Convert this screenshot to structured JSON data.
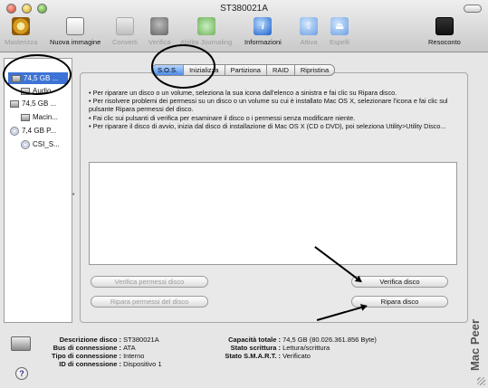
{
  "window": {
    "title": "ST380021A"
  },
  "toolbar": {
    "items": [
      {
        "label": "Masterizza",
        "icon": "burn-icon",
        "enabled": false
      },
      {
        "label": "Nuova immagine",
        "icon": "new-image-icon",
        "enabled": true
      },
      {
        "label": "Converti",
        "icon": "convert-icon",
        "enabled": false
      },
      {
        "label": "Verifica",
        "icon": "microscope-icon",
        "enabled": false
      },
      {
        "label": "Abilita Journaling",
        "icon": "journaling-icon",
        "enabled": false
      },
      {
        "label": "Informazioni",
        "icon": "info-icon",
        "enabled": true
      },
      {
        "label": "Attiva",
        "icon": "mount-icon",
        "enabled": false
      },
      {
        "label": "Espelli",
        "icon": "eject-icon",
        "enabled": false
      },
      {
        "label": "Resoconto",
        "icon": "log-icon",
        "enabled": true
      }
    ]
  },
  "sidebar": {
    "items": [
      {
        "label": "74,5 GB ...",
        "type": "disk",
        "selected": true
      },
      {
        "label": "Audio",
        "type": "volume",
        "selected": false
      },
      {
        "label": "74,5 GB ...",
        "type": "disk",
        "selected": false
      },
      {
        "label": "Macin...",
        "type": "volume",
        "selected": false
      },
      {
        "label": "7,4 GB P...",
        "type": "optical",
        "selected": false
      },
      {
        "label": "CSI_S...",
        "type": "optical-volume",
        "selected": false
      }
    ]
  },
  "tabs": [
    {
      "label": "S.O.S.",
      "active": true
    },
    {
      "label": "Inizializza",
      "active": false
    },
    {
      "label": "Partiziona",
      "active": false
    },
    {
      "label": "RAID",
      "active": false
    },
    {
      "label": "Ripristina",
      "active": false
    }
  ],
  "sos": {
    "instructions": [
      "• Per riparare un disco o un volume, seleziona la sua icona dall'elenco a sinistra e fai clic su Ripara disco.",
      "• Per risolvere problemi dei permessi su un disco o un volume su cui è installato Mac OS X, selezionare l'icona e fai clic sul pulsante Ripara permessi del disco.",
      "• Fai clic sui pulsanti di verifica per esaminare il disco o i permessi senza modificare niente.",
      "• Per riparare il disco di avvio, inizia dal disco di installazione di Mac OS X (CD o DVD), poi seleziona Utility>Utility Disco..."
    ],
    "buttons": {
      "verify_permissions": "Verifica permessi disco",
      "repair_permissions": "Ripara permessi del disco",
      "verify_disk": "Verifica disco",
      "repair_disk": "Ripara disco"
    }
  },
  "disk_info": {
    "left": [
      {
        "key": "Descrizione disco :",
        "value": "ST380021A"
      },
      {
        "key": "Bus di connessione :",
        "value": "ATA"
      },
      {
        "key": "Tipo di connessione :",
        "value": "Interno"
      },
      {
        "key": "ID di connessione :",
        "value": "Dispositivo 1"
      }
    ],
    "right": [
      {
        "key": "Capacità totale :",
        "value": "74,5 GB (80.026.361.856 Byte)"
      },
      {
        "key": "Stato scrittura :",
        "value": "Lettura/scrittura"
      },
      {
        "key": "Stato S.M.A.R.T. :",
        "value": "Verificato"
      }
    ]
  },
  "help": {
    "label": "?"
  },
  "watermark": "Mac Peer"
}
